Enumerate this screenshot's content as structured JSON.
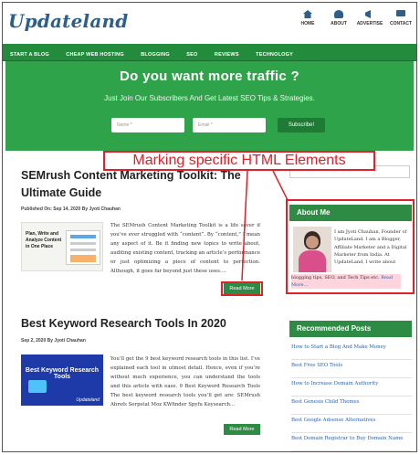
{
  "header": {
    "logo": "Updateland",
    "nav": [
      {
        "label": "HOME",
        "icon": "home-icon"
      },
      {
        "label": "ABOUT",
        "icon": "user-icon"
      },
      {
        "label": "ADVERTISE",
        "icon": "megaphone-icon"
      },
      {
        "label": "CONTACT",
        "icon": "mail-icon"
      }
    ]
  },
  "menu": [
    "START A BLOG",
    "CHEAP WEB HOSTING",
    "BLOGGING",
    "SEO",
    "REVIEWS",
    "TECHNOLOGY"
  ],
  "hero": {
    "title": "Do you want more traffic ?",
    "subtitle": "Just Join Our Subscribers And Get Latest SEO Tips & Strategies.",
    "name_placeholder": "Name *",
    "email_placeholder": "Email *",
    "button": "Subscribe!"
  },
  "overlay": {
    "label": "Marking specific HTML Elements"
  },
  "posts": [
    {
      "title_line1": "SEMrush Content Marketing Toolkit: The",
      "title_line2": "Ultimate Guide",
      "meta_prefix": "Published On:",
      "meta_date": "Sep 14, 2020",
      "meta_author": "By Jyoti Chauhan",
      "thumb_lines": [
        "Plan, Write and",
        "Analyze Content",
        "in One Place"
      ],
      "excerpt": "The SEMrush Content Marketing Toolkit is a life saver if you’ve ever struggled with “content”. By “content,” I mean any aspect of it. Be it finding new topics to write about, auditing existing content, tracking an article’s performance or just optimizing a piece of content to perfection. Although, it goes far beyond just these uses....",
      "more": "Read More"
    },
    {
      "title_line1": "Best Keyword Research Tools In 2020",
      "meta_prefix": "",
      "meta_date": "Sep 2, 2020",
      "meta_author": "By Jyoti Chauhan",
      "thumb_text": "Best Keyword Research Tools",
      "thumb_brand": "Updateland",
      "excerpt": "You’ll get the 9 best keyword research tools in this list. I’ve explained each tool in utmost detail. Hence, even if you’re without much experience, you can understand the tools and this article with ease. 9 Best Keyword Research Tools The best keyword research tools you’ll get are: SEMrush Ahrefs Serpstat Moz KWfinder Spyfu Keysearch...",
      "more": "Read More"
    }
  ],
  "sidebar": {
    "about_title": "About Me",
    "about_text": "I am Jyoti Chauhan, Founder of UpdateLand. I am a Blogger, Affiliate Marketer and a Digital Marketer from India. At UpdateLand, I write about",
    "about_tail": "blogging tips, SEO, and Tech Tips etc.",
    "about_link": "Read More...",
    "recent_title": "Recommended Posts",
    "recent": [
      "How to Start a Blog And Make Money",
      "Best Free SEO Tools",
      "How to Increase Domain Authority",
      "Best Genesis Child Themes",
      "Best Google Adsense Alternatives",
      "Best Domain Registrar to Buy Domain Name"
    ]
  },
  "colors": {
    "brand_green": "#2fa34a",
    "nav_green": "#228b3c",
    "highlight_red": "#e0202a",
    "logo_blue": "#2e5f8a"
  }
}
